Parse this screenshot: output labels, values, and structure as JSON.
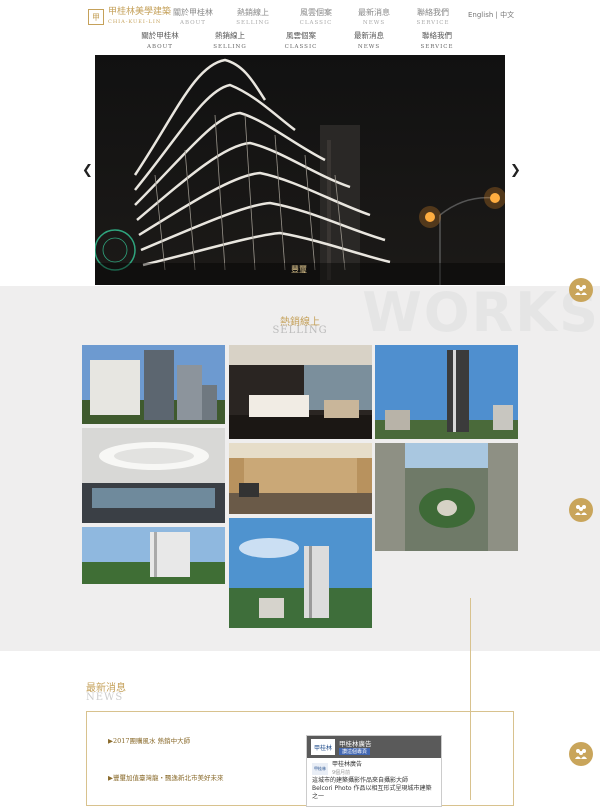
{
  "header": {
    "logo_text": "甲桂林美學建築",
    "logo_sub": "CHIA-KUEI-LIN",
    "lang": "English | 中文",
    "nav_row1": [
      {
        "label": "關於甲桂林",
        "en": "ABOUT"
      },
      {
        "label": "熱銷線上",
        "en": "SELLING"
      },
      {
        "label": "風雲個案",
        "en": "CLASSIC"
      },
      {
        "label": "最新消息",
        "en": "NEWS"
      },
      {
        "label": "聯絡我們",
        "en": "SERVICE"
      }
    ],
    "nav_row2": [
      {
        "label": "關於甲桂林",
        "en": "ABOUT"
      },
      {
        "label": "熱銷線上",
        "en": "SELLING"
      },
      {
        "label": "風雲個案",
        "en": "CLASSIC"
      },
      {
        "label": "最新消息",
        "en": "NEWS"
      },
      {
        "label": "聯絡我們",
        "en": "SERVICE"
      }
    ]
  },
  "hero": {
    "caption": "豐璽",
    "prev_icon": "chevron-left-icon",
    "next_icon": "chevron-right-icon"
  },
  "works": {
    "bg_text": "WORKS",
    "title": "熱銷線上",
    "title_en": "SELLING"
  },
  "news": {
    "title": "最新消息",
    "title_en": "NEWS",
    "items": [
      "▶2017團購風水 熱銷中大師",
      "▶豐璽加值臺灣龍・飄逸新北市美好未來"
    ],
    "fb": {
      "logo": "甲桂林",
      "page_name": "甲桂林廣告",
      "like": "讚這個專頁",
      "post_name": "甲桂林廣告",
      "post_sub": "9個月前",
      "post_text": "這城市的建築攝影作品來自攝影大師",
      "post_text2": "Belcori Photo 作品以相互形式呈現城市建築之一"
    }
  },
  "side_buttons": [
    "group-icon",
    "group-icon",
    "group-icon"
  ]
}
